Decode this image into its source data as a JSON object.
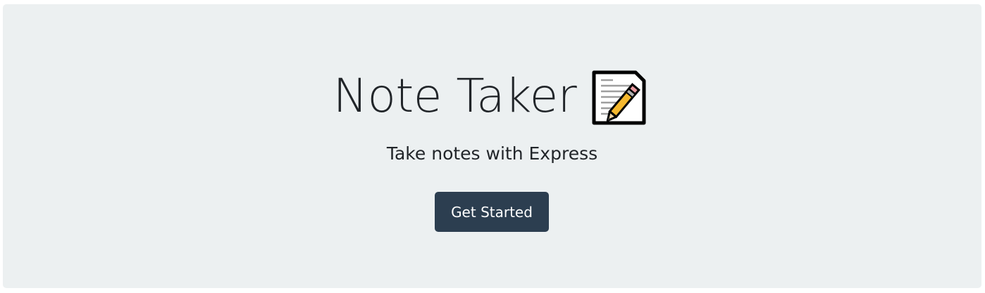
{
  "hero": {
    "title": "Note Taker",
    "title_icon": "memo-icon",
    "subtitle": "Take notes with Express",
    "cta_label": "Get Started"
  },
  "colors": {
    "hero_background": "#ecf0f1",
    "button_background": "#2c3e50",
    "button_text": "#ffffff",
    "text": "#212529"
  }
}
